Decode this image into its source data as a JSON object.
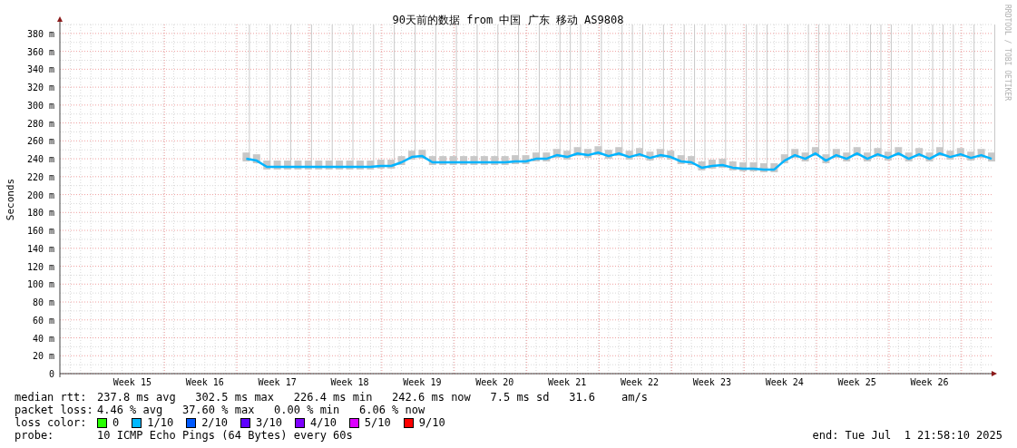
{
  "title": "90天前的数据 from 中国 广东 移动 AS9808",
  "credit": "RRDTOOL / TOBI OETIKER",
  "chart_data": {
    "type": "line",
    "grid": true,
    "ylabel": "Seconds",
    "ylim": [
      0,
      390
    ],
    "yticks": [
      {
        "value": 0,
        "label": "0"
      },
      {
        "value": 20,
        "label": "20 m"
      },
      {
        "value": 40,
        "label": "40 m"
      },
      {
        "value": 60,
        "label": "60 m"
      },
      {
        "value": 80,
        "label": "80 m"
      },
      {
        "value": 100,
        "label": "100 m"
      },
      {
        "value": 120,
        "label": "120 m"
      },
      {
        "value": 140,
        "label": "140 m"
      },
      {
        "value": 160,
        "label": "160 m"
      },
      {
        "value": 180,
        "label": "180 m"
      },
      {
        "value": 200,
        "label": "200 m"
      },
      {
        "value": 220,
        "label": "220 m"
      },
      {
        "value": 240,
        "label": "240 m"
      },
      {
        "value": 260,
        "label": "260 m"
      },
      {
        "value": 280,
        "label": "280 m"
      },
      {
        "value": 300,
        "label": "300 m"
      },
      {
        "value": 320,
        "label": "320 m"
      },
      {
        "value": 340,
        "label": "340 m"
      },
      {
        "value": 360,
        "label": "360 m"
      },
      {
        "value": 380,
        "label": "380 m"
      }
    ],
    "categories": [
      null,
      null,
      null,
      null,
      null,
      null,
      null,
      "Week 15",
      null,
      null,
      null,
      null,
      null,
      null,
      "Week 16",
      null,
      null,
      null,
      null,
      null,
      null,
      "Week 17",
      null,
      null,
      null,
      null,
      null,
      null,
      "Week 18",
      null,
      null,
      null,
      null,
      null,
      null,
      "Week 19",
      null,
      null,
      null,
      null,
      null,
      null,
      "Week 20",
      null,
      null,
      null,
      null,
      null,
      null,
      "Week 21",
      null,
      null,
      null,
      null,
      null,
      null,
      "Week 22",
      null,
      null,
      null,
      null,
      null,
      null,
      "Week 23",
      null,
      null,
      null,
      null,
      null,
      null,
      "Week 24",
      null,
      null,
      null,
      null,
      null,
      null,
      "Week 25",
      null,
      null,
      null,
      null,
      null,
      null,
      "Week 26",
      null,
      null,
      null,
      null,
      null,
      null
    ],
    "series": [
      {
        "color": "#00b4ff",
        "values": [
          null,
          null,
          null,
          null,
          null,
          null,
          null,
          null,
          null,
          null,
          null,
          null,
          null,
          null,
          null,
          null,
          null,
          null,
          240,
          238,
          231,
          231,
          231,
          231,
          231,
          231,
          231,
          231,
          231,
          231,
          231,
          232,
          232,
          236,
          242,
          243,
          236,
          236,
          236,
          236,
          236,
          236,
          236,
          236,
          237,
          237,
          240,
          240,
          244,
          242,
          246,
          244,
          247,
          243,
          246,
          242,
          245,
          241,
          244,
          242,
          237,
          236,
          230,
          232,
          233,
          230,
          229,
          229,
          228,
          228,
          238,
          244,
          240,
          246,
          238,
          244,
          240,
          246,
          240,
          245,
          241,
          246,
          240,
          245,
          240,
          246,
          242,
          245,
          241,
          244,
          240
        ]
      }
    ]
  },
  "legend": [
    {
      "label": "median rtt:",
      "text": "237.8 ms avg   302.5 ms max   226.4 ms min   242.6 ms now   7.5 ms sd   31.6    am/s"
    },
    {
      "label": "packet loss:",
      "text": "4.46 % avg   37.60 % max   0.00 % min   6.06 % now"
    }
  ],
  "loss_color": {
    "label": "loss color:",
    "items": [
      {
        "label": "0",
        "color": "#26ff00"
      },
      {
        "label": "1/10",
        "color": "#00b8ff"
      },
      {
        "label": "2/10",
        "color": "#0059ff"
      },
      {
        "label": "3/10",
        "color": "#5e00ff"
      },
      {
        "label": "4/10",
        "color": "#7e00ff"
      },
      {
        "label": "5/10",
        "color": "#dd00ff"
      },
      {
        "label": "9/10",
        "color": "#ff0000"
      }
    ]
  },
  "probe": {
    "label": "probe:",
    "text": "10 ICMP Echo Pings (64 Bytes) every 60s"
  },
  "end": "end: Tue Jul  1 21:58:10 2025"
}
